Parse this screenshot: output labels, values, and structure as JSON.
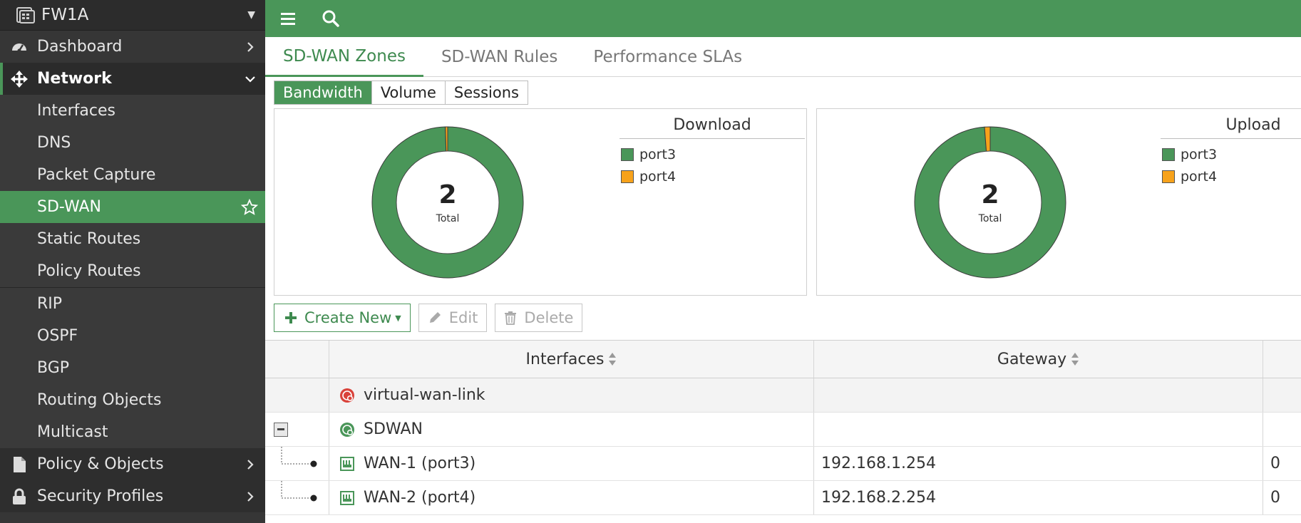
{
  "device": {
    "name": "FW1A"
  },
  "nav": {
    "top_items": {
      "dashboard": "Dashboard",
      "network": "Network",
      "policy_objects": "Policy & Objects",
      "security_profiles": "Security Profiles"
    },
    "network_children": [
      {
        "label": "Interfaces"
      },
      {
        "label": "DNS"
      },
      {
        "label": "Packet Capture"
      },
      {
        "label": "SD-WAN"
      },
      {
        "label": "Static Routes"
      },
      {
        "label": "Policy Routes"
      },
      {
        "label": "RIP"
      },
      {
        "label": "OSPF"
      },
      {
        "label": "BGP"
      },
      {
        "label": "Routing Objects"
      },
      {
        "label": "Multicast"
      }
    ]
  },
  "tabs": [
    "SD-WAN Zones",
    "SD-WAN Rules",
    "Performance SLAs"
  ],
  "segments": [
    "Bandwidth",
    "Volume",
    "Sessions"
  ],
  "colors": {
    "accent": "#4a9659",
    "port3": "#4a9659",
    "port4": "#f7a21b",
    "error_icon": "#d9423a"
  },
  "charts": {
    "download": {
      "title": "Download",
      "total": "2",
      "total_label": "Total",
      "legend": [
        {
          "name": "port3",
          "color": "#4a9659"
        },
        {
          "name": "port4",
          "color": "#f7a21b"
        }
      ]
    },
    "upload": {
      "title": "Upload",
      "total": "2",
      "total_label": "Total",
      "legend": [
        {
          "name": "port3",
          "color": "#4a9659"
        },
        {
          "name": "port4",
          "color": "#f7a21b"
        }
      ]
    }
  },
  "chart_data": [
    {
      "type": "pie",
      "title": "Download",
      "categories": [
        "port3",
        "port4"
      ],
      "values": [
        99.5,
        0.5
      ]
    },
    {
      "type": "pie",
      "title": "Upload",
      "categories": [
        "port3",
        "port4"
      ],
      "values": [
        98.8,
        1.2
      ]
    }
  ],
  "toolbar": {
    "create_new": "Create New",
    "edit": "Edit",
    "delete": "Delete"
  },
  "table": {
    "headers": {
      "interfaces": "Interfaces",
      "gateway": "Gateway"
    },
    "rows": [
      {
        "name": "virtual-wan-link",
        "gateway": "",
        "extra": ""
      },
      {
        "name": "SDWAN",
        "gateway": "",
        "extra": ""
      },
      {
        "name": "WAN-1 (port3)",
        "gateway": "192.168.1.254",
        "extra": "0"
      },
      {
        "name": "WAN-2 (port4)",
        "gateway": "192.168.2.254",
        "extra": "0"
      }
    ]
  }
}
